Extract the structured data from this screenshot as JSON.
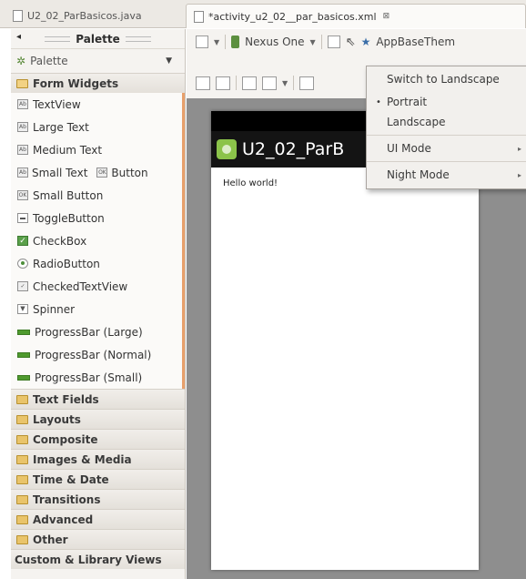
{
  "tabs": [
    {
      "label": "U2_02_ParBasicos.java"
    },
    {
      "label": "*activity_u2_02__par_basicos.xml",
      "close": "⊠"
    }
  ],
  "palette": {
    "title": "Palette",
    "combo": "Palette",
    "categories_open": "Form Widgets",
    "widgets": [
      "TextView",
      "Large Text",
      "Medium Text",
      "Small Text",
      "Button",
      "Small Button",
      "ToggleButton",
      "CheckBox",
      "RadioButton",
      "CheckedTextView",
      "Spinner",
      "ProgressBar (Large)",
      "ProgressBar (Normal)",
      "ProgressBar (Small)"
    ],
    "categories": [
      "Text Fields",
      "Layouts",
      "Composite",
      "Images & Media",
      "Time & Date",
      "Transitions",
      "Advanced",
      "Other"
    ],
    "custom": "Custom & Library Views"
  },
  "toolbar": {
    "device": "Nexus One",
    "theme": "AppBaseThem"
  },
  "device": {
    "app_title": "U2_02_ParB",
    "hello": "Hello world!"
  },
  "menu": {
    "items": [
      {
        "label": "Switch to Landscape"
      },
      {
        "label": "Portrait",
        "bullet": "•"
      },
      {
        "label": "Landscape"
      },
      {
        "label": "UI Mode",
        "sub": "▸"
      },
      {
        "label": "Night Mode",
        "sub": "▸"
      }
    ]
  },
  "colors": {
    "accent": "#e8a06c",
    "widget_green": "#4f9a2e",
    "folder": "#e9c46a"
  }
}
